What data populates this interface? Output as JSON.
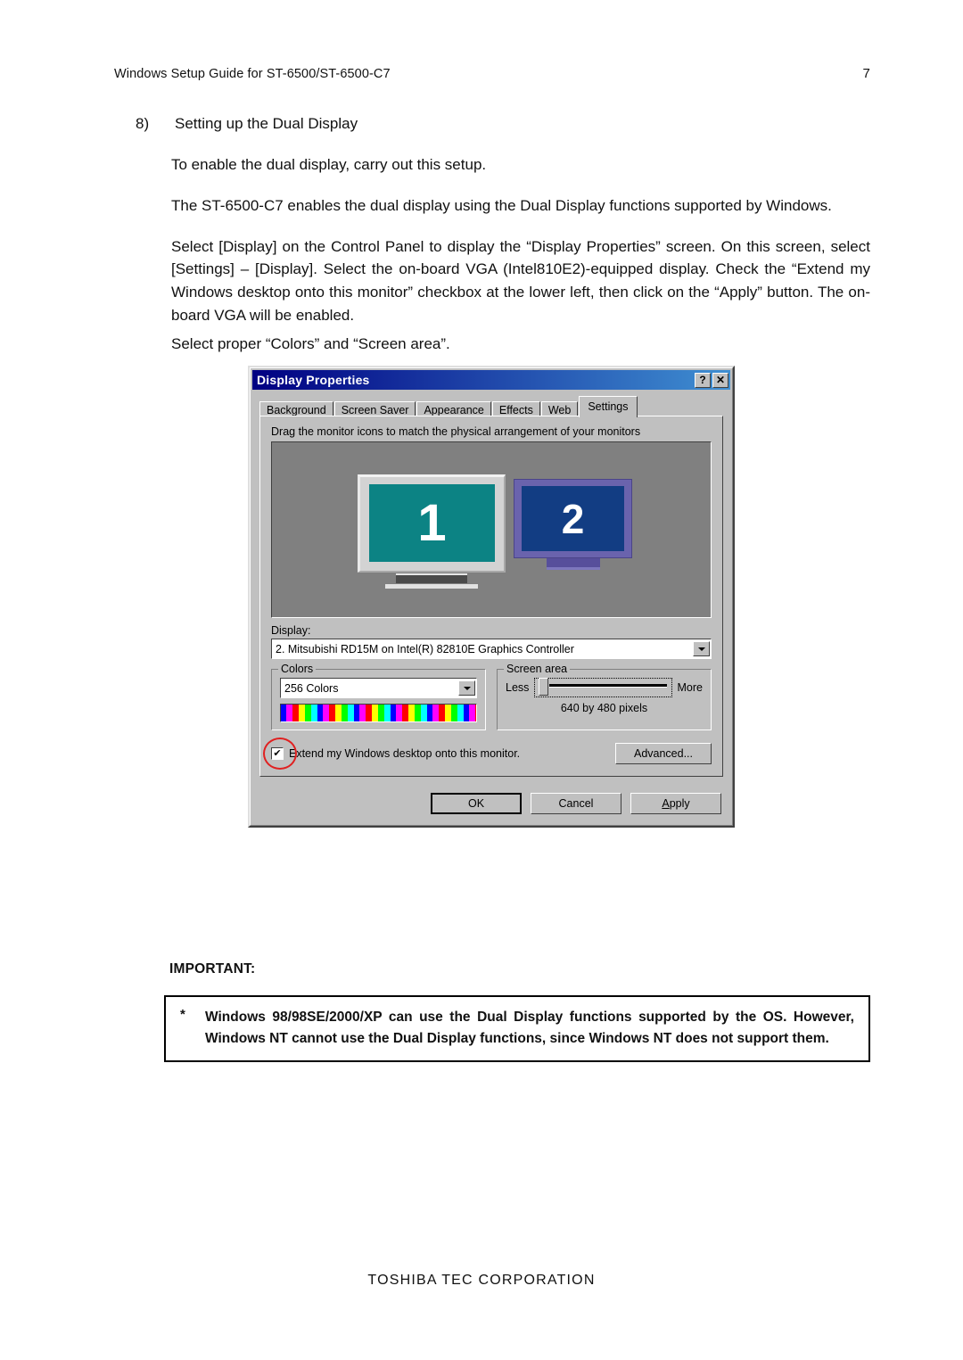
{
  "page": {
    "header_title": "Windows Setup Guide for ST-6500/ST-6500-C7",
    "page_number": "7",
    "footer": "TOSHIBA TEC CORPORATION"
  },
  "section": {
    "number": "8)",
    "heading": "Setting up the Dual Display",
    "intro": "To enable the dual display, carry out this setup.",
    "para1": "The ST-6500-C7 enables the dual display using the Dual Display functions supported by Windows.",
    "para2": "Select [Display] on the Control Panel to display the “Display Properties” screen.  On this screen, select [Settings] – [Display].   Select the on-board VGA (Intel810E2)-equipped display.  Check the “Extend my Windows desktop onto this monitor” checkbox at the lower left, then click on the “Apply” button.   The on-board VGA will be enabled.",
    "para3": "Select proper “Colors” and “Screen area”."
  },
  "dialog": {
    "title": "Display Properties",
    "help_button": "?",
    "close_button": "✕",
    "tabs": [
      {
        "label": "Background",
        "active": false
      },
      {
        "label": "Screen Saver",
        "active": false
      },
      {
        "label": "Appearance",
        "active": false
      },
      {
        "label": "Effects",
        "active": false
      },
      {
        "label": "Web",
        "active": false
      },
      {
        "label": "Settings",
        "active": true
      }
    ],
    "hint": "Drag the monitor icons to match the physical arrangement of your monitors",
    "monitors": [
      {
        "number": "1",
        "screen_color": "#0c8384",
        "bezel_color": "#d3d3d3"
      },
      {
        "number": "2",
        "screen_color": "#123d83",
        "bezel_color": "#6a63ad"
      }
    ],
    "display_label": "Display:",
    "display_value": "2. Mitsubishi RD15M on Intel(R) 82810E Graphics Controller",
    "colors": {
      "group_title": "Colors",
      "value": "256 Colors"
    },
    "screen_area": {
      "group_title": "Screen area",
      "less_label": "Less",
      "more_label": "More",
      "resolution": "640 by 480 pixels",
      "slider_position_percent": 0
    },
    "extend_checkbox": {
      "label": "Extend my Windows desktop onto this monitor.",
      "checked": true,
      "check_glyph": "✔",
      "annotation_color": "#e02020"
    },
    "advanced_button": "Advanced...",
    "buttons": {
      "ok": "OK",
      "cancel": "Cancel",
      "apply_prefix": "A",
      "apply_rest": "pply"
    }
  },
  "important": {
    "label": "IMPORTANT:",
    "bullet": "*",
    "text": "Windows 98/98SE/2000/XP can use the Dual Display functions supported by the OS.   However, Windows NT cannot use the Dual Display functions, since Windows NT does not support them."
  }
}
